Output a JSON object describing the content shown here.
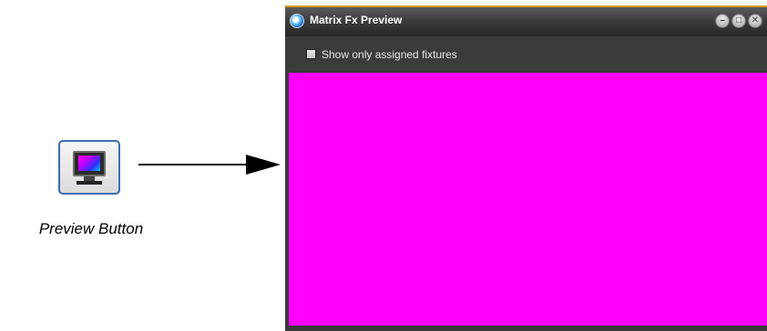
{
  "caption": {
    "preview_button": "Preview Button"
  },
  "icons": {
    "preview_button_icon": "monitor-icon",
    "title_icon": "app-globe-icon",
    "minimize": "minimize-icon",
    "maximize": "maximize-icon",
    "close": "close-icon"
  },
  "window": {
    "title": "Matrix Fx Preview",
    "controls": {
      "minimize_glyph": "–",
      "maximize_glyph": "□",
      "close_glyph": "✕"
    },
    "checkbox": {
      "label": "Show only assigned fixtures",
      "checked": false
    },
    "preview_color": "#ff00ff"
  },
  "colors": {
    "window_bg": "#3a3a3a",
    "title_accent": "#d69a1a",
    "preview": "#ff00ff",
    "button_border": "#3a6fb0"
  }
}
